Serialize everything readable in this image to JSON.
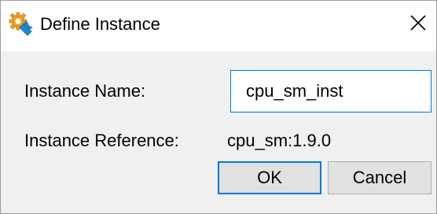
{
  "window": {
    "title": "Define Instance",
    "icon": "wrench-gear-icon",
    "close_icon": "close-icon"
  },
  "form": {
    "instance_name_label": "Instance Name:",
    "instance_name_value": "cpu_sm_inst",
    "instance_reference_label": "Instance Reference:",
    "instance_reference_value": "cpu_sm:1.9.0"
  },
  "buttons": {
    "ok_label": "OK",
    "cancel_label": "Cancel"
  },
  "colors": {
    "focus_border": "#0078d7",
    "icon_gear": "#f2a32a",
    "icon_wrench": "#1c8bd6"
  }
}
